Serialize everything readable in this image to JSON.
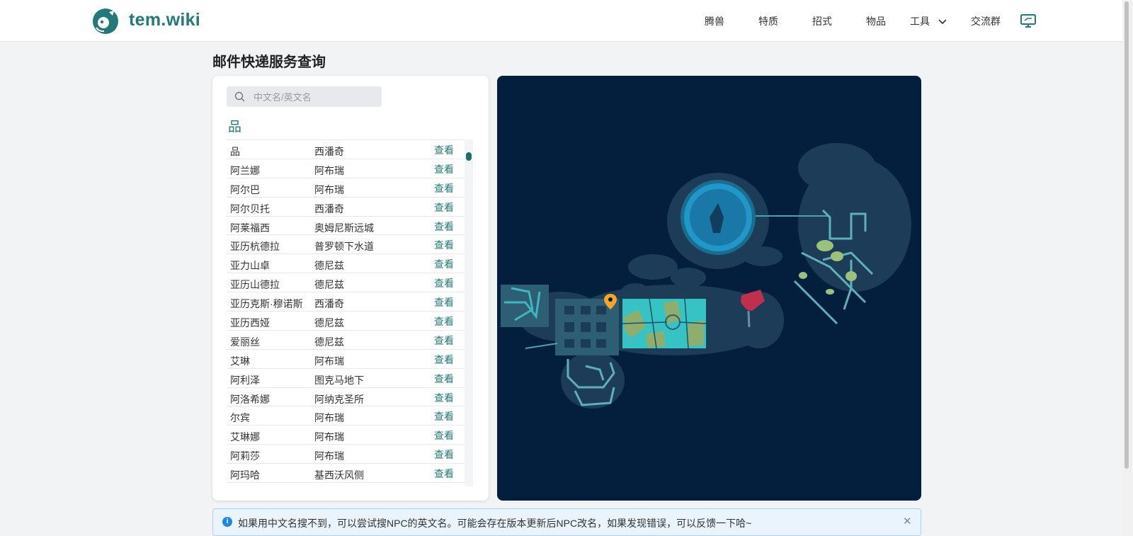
{
  "header": {
    "brand": "tem.wiki",
    "nav": [
      "腾兽",
      "特质",
      "招式",
      "物品",
      "工具",
      "交流群"
    ],
    "icons": {
      "logo": "tem-logo-icon",
      "tools_dropdown": "chevron-down-icon",
      "desktop": "monitor-icon"
    }
  },
  "page": {
    "title": "邮件快递服务查询"
  },
  "search": {
    "placeholder": "中文名/英文名",
    "value": "",
    "icon": "search-icon"
  },
  "query_label": "品",
  "table": {
    "rows": [
      {
        "name": "品",
        "location": "西潘奇",
        "action": "查看"
      },
      {
        "name": "阿兰娜",
        "location": "阿布瑞",
        "action": "查看"
      },
      {
        "name": "阿尔巴",
        "location": "阿布瑞",
        "action": "查看"
      },
      {
        "name": "阿尔贝托",
        "location": "西潘奇",
        "action": "查看"
      },
      {
        "name": "阿莱福西",
        "location": "奥姆尼斯远城",
        "action": "查看"
      },
      {
        "name": "亚历杭德拉",
        "location": "普罗顿下水道",
        "action": "查看"
      },
      {
        "name": "亚力山卓",
        "location": "德尼兹",
        "action": "查看"
      },
      {
        "name": "亚历山德拉",
        "location": "德尼兹",
        "action": "查看"
      },
      {
        "name": "亚历克斯·穆诺斯",
        "location": "西潘奇",
        "action": "查看"
      },
      {
        "name": "亚历西娅",
        "location": "德尼兹",
        "action": "查看"
      },
      {
        "name": "爱丽丝",
        "location": "德尼兹",
        "action": "查看"
      },
      {
        "name": "艾琳",
        "location": "阿布瑞",
        "action": "查看"
      },
      {
        "name": "阿利泽",
        "location": "图克马地下",
        "action": "查看"
      },
      {
        "name": "阿洛希娜",
        "location": "阿纳克圣所",
        "action": "查看"
      },
      {
        "name": "尔宾",
        "location": "阿布瑞",
        "action": "查看"
      },
      {
        "name": "艾琳娜",
        "location": "阿布瑞",
        "action": "查看"
      },
      {
        "name": "阿莉莎",
        "location": "阿布瑞",
        "action": "查看"
      },
      {
        "name": "阿玛哈",
        "location": "基西沃风侧",
        "action": "查看"
      }
    ]
  },
  "alert": {
    "message": "如果用中文名搜不到，可以尝试搜NPC的英文名。可能会存在版本更新后NPC改名，如果发现错误，可以反馈一下哈~",
    "info_icon": "i",
    "close": "✕"
  },
  "colors": {
    "accent": "#217a78",
    "map_bg": "#041f3d",
    "marker": "#f5a623",
    "highlight_area": "#c0304e"
  }
}
